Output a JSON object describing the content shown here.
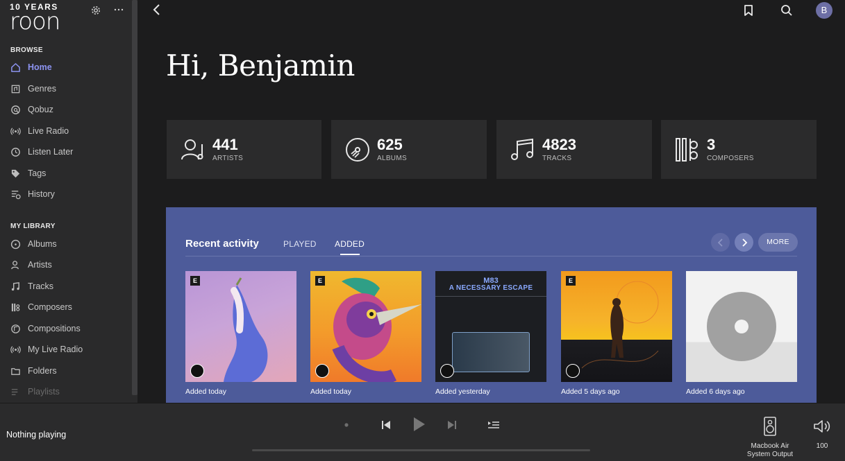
{
  "logo": {
    "top": "10 YEARS",
    "word": "roon"
  },
  "sidebar": {
    "browse_label": "BROWSE",
    "browse": [
      {
        "label": "Home",
        "icon": "home-icon",
        "active": true
      },
      {
        "label": "Genres",
        "icon": "genres-icon"
      },
      {
        "label": "Qobuz",
        "icon": "qobuz-icon"
      },
      {
        "label": "Live Radio",
        "icon": "radio-icon"
      },
      {
        "label": "Listen Later",
        "icon": "clock-icon"
      },
      {
        "label": "Tags",
        "icon": "tag-icon"
      },
      {
        "label": "History",
        "icon": "history-icon"
      }
    ],
    "library_label": "MY LIBRARY",
    "library": [
      {
        "label": "Albums",
        "icon": "disc-icon"
      },
      {
        "label": "Artists",
        "icon": "person-icon"
      },
      {
        "label": "Tracks",
        "icon": "music-note-icon"
      },
      {
        "label": "Composers",
        "icon": "composer-icon"
      },
      {
        "label": "Compositions",
        "icon": "composition-icon"
      },
      {
        "label": "My Live Radio",
        "icon": "radio-icon"
      },
      {
        "label": "Folders",
        "icon": "folder-icon"
      },
      {
        "label": "Playlists",
        "icon": "playlist-icon"
      }
    ]
  },
  "header": {
    "greeting": "Hi, Benjamin",
    "avatar_letter": "B"
  },
  "stats": [
    {
      "value": "441",
      "label": "ARTISTS",
      "icon": "artist-icon"
    },
    {
      "value": "625",
      "label": "ALBUMS",
      "icon": "disc-icon"
    },
    {
      "value": "4823",
      "label": "TRACKS",
      "icon": "music-note-icon"
    },
    {
      "value": "3",
      "label": "COMPOSERS",
      "icon": "composer-icon"
    }
  ],
  "recent": {
    "title": "Recent activity",
    "tabs": [
      "PLAYED",
      "ADDED"
    ],
    "active_tab": "ADDED",
    "more_label": "MORE",
    "albums": [
      {
        "caption": "Added today",
        "explicit": true,
        "cover_text": ""
      },
      {
        "caption": "Added today",
        "explicit": true,
        "cover_text": ""
      },
      {
        "caption": "Added yesterday",
        "explicit": false,
        "cover_text": "M83",
        "cover_subtitle": "A NECESSARY ESCAPE"
      },
      {
        "caption": "Added 5 days ago",
        "explicit": true,
        "cover_text": ""
      },
      {
        "caption": "Added 6 days ago",
        "explicit": false,
        "cover_text": ""
      }
    ]
  },
  "player": {
    "now_playing": "Nothing playing",
    "zone_line1": "Macbook Air",
    "zone_line2": "System Output",
    "volume": "100"
  },
  "colors": {
    "accent": "#8c93f0",
    "panel": "#4d5b9a",
    "background": "#1c1c1d"
  }
}
